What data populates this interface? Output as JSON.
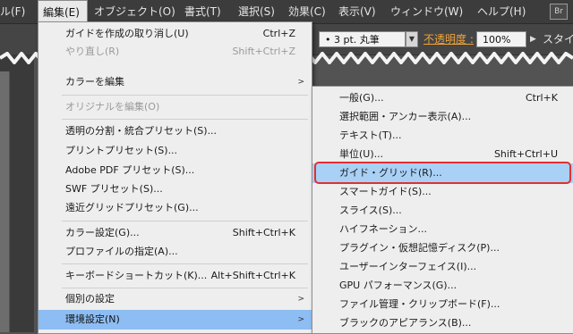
{
  "menubar": {
    "items": [
      "ル(F)",
      "編集(E)",
      "オブジェクト(O)",
      "書式(T)",
      "選択(S)",
      "効果(C)",
      "表示(V)",
      "ウィンドウ(W)",
      "ヘルプ(H)"
    ],
    "br_badge": "Br"
  },
  "toolbar": {
    "stroke_field": "•  3 pt. 丸筆",
    "opacity_label": "不透明度 :",
    "opacity_value": "100%",
    "style_label": "スタイ"
  },
  "edit_menu": {
    "items": [
      {
        "label": "ガイドを作成の取り消し(U)",
        "shortcut": "Ctrl+Z"
      },
      {
        "label": "やり直し(R)",
        "shortcut": "Shift+Ctrl+Z"
      },
      {
        "label": "カラーを編集"
      },
      {
        "label": "オリジナルを編集(O)"
      },
      {
        "label": "透明の分割・統合プリセット(S)..."
      },
      {
        "label": "プリントプリセット(S)..."
      },
      {
        "label": "Adobe PDF プリセット(S)..."
      },
      {
        "label": "SWF プリセット(S)..."
      },
      {
        "label": "遠近グリッドプリセット(G)..."
      },
      {
        "label": "カラー設定(G)...",
        "shortcut": "Shift+Ctrl+K"
      },
      {
        "label": "プロファイルの指定(A)..."
      },
      {
        "label": "キーボードショートカット(K)...",
        "shortcut": "Alt+Shift+Ctrl+K"
      },
      {
        "label": "個別の設定"
      },
      {
        "label": "環境設定(N)"
      }
    ]
  },
  "pref_submenu": {
    "items": [
      {
        "label": "一般(G)...",
        "shortcut": "Ctrl+K"
      },
      {
        "label": "選択範囲・アンカー表示(A)..."
      },
      {
        "label": "テキスト(T)..."
      },
      {
        "label": "単位(U)...",
        "shortcut": "Shift+Ctrl+U"
      },
      {
        "label": "ガイド・グリッド(R)..."
      },
      {
        "label": "スマートガイド(S)..."
      },
      {
        "label": "スライス(S)..."
      },
      {
        "label": "ハイフネーション..."
      },
      {
        "label": "プラグイン・仮想記憶ディスク(P)..."
      },
      {
        "label": "ユーザーインターフェイス(I)..."
      },
      {
        "label": "GPU パフォーマンス(G)..."
      },
      {
        "label": "ファイル管理・クリップボード(F)..."
      },
      {
        "label": "ブラックのアピアランス(B)..."
      }
    ]
  }
}
